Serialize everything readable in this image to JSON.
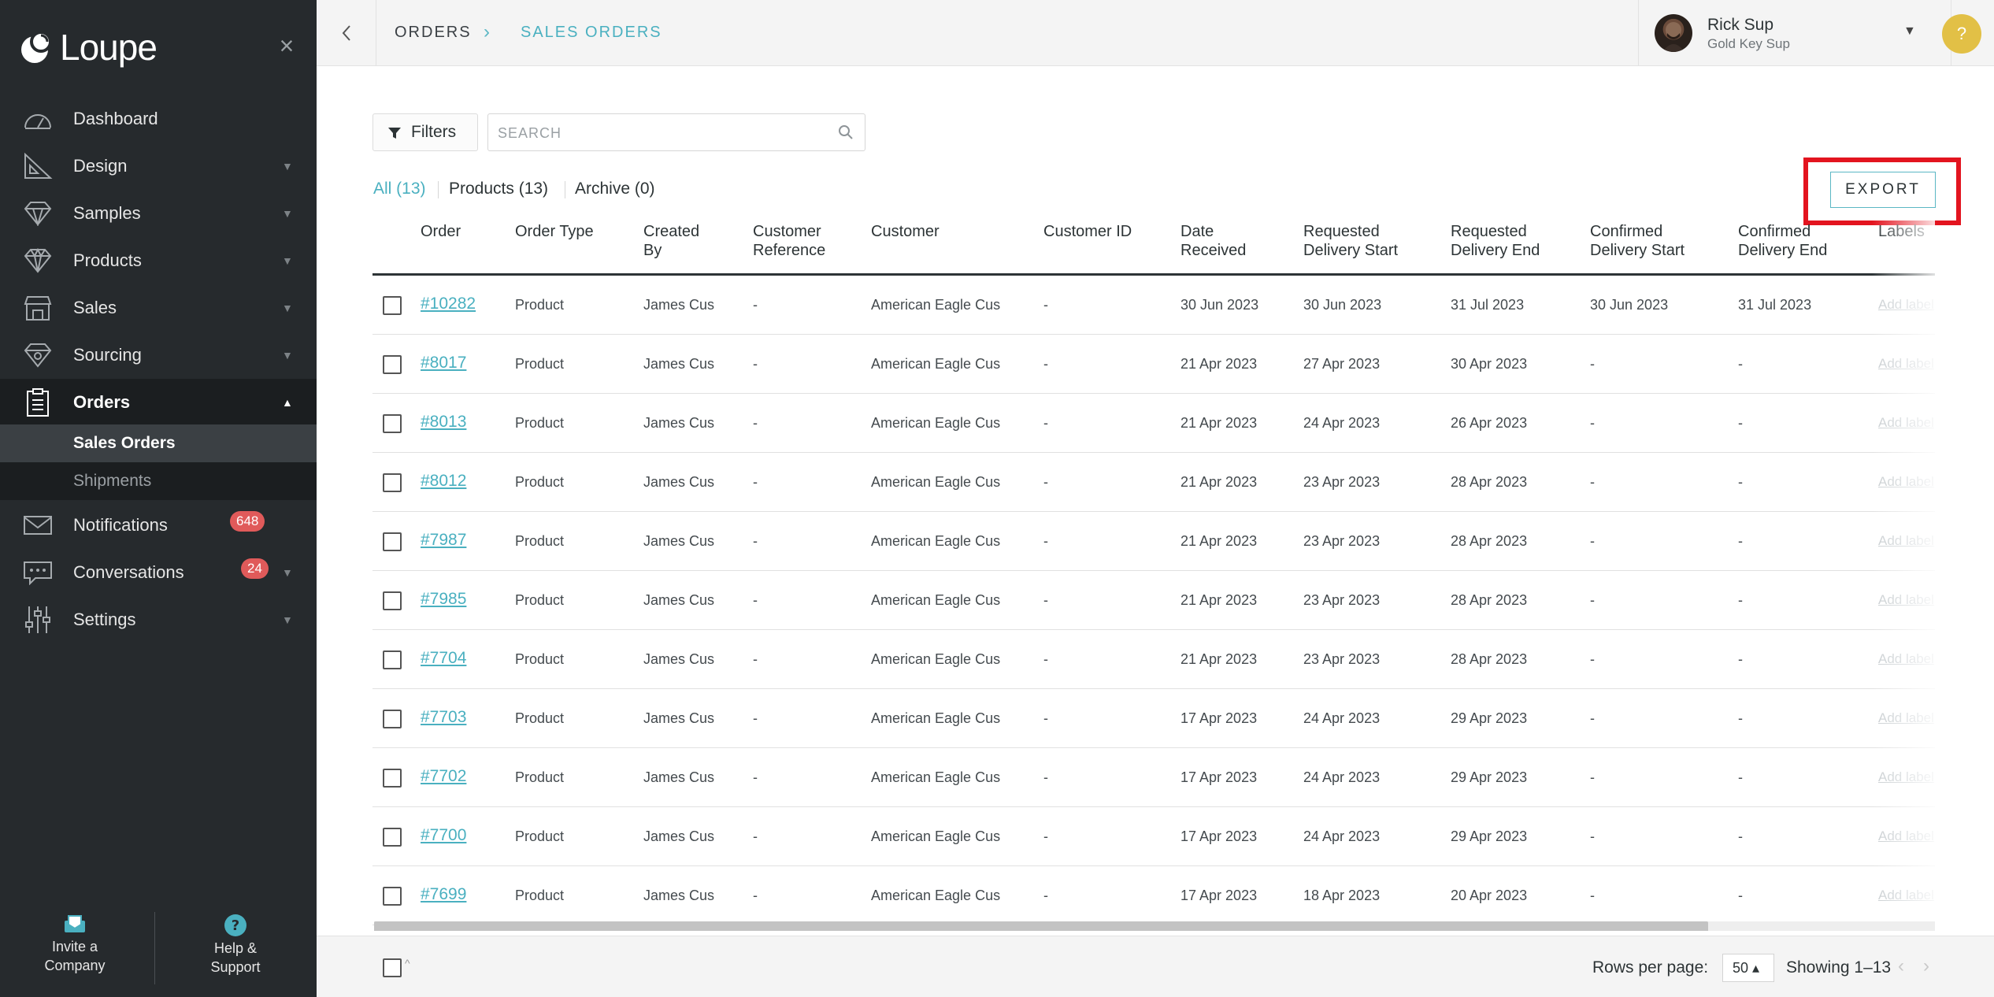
{
  "brand": {
    "name": "Loupe"
  },
  "sidebar": {
    "items": [
      {
        "label": "Dashboard",
        "icon": "dashboard-icon"
      },
      {
        "label": "Design",
        "icon": "design-icon"
      },
      {
        "label": "Samples",
        "icon": "gem-icon"
      },
      {
        "label": "Products",
        "icon": "diamond-icon"
      },
      {
        "label": "Sales",
        "icon": "store-icon"
      },
      {
        "label": "Sourcing",
        "icon": "sourcing-icon"
      },
      {
        "label": "Orders",
        "icon": "clipboard-icon"
      },
      {
        "label": "Notifications",
        "icon": "envelope-icon",
        "badge": "648"
      },
      {
        "label": "Conversations",
        "icon": "chat-icon",
        "badge": "24"
      },
      {
        "label": "Settings",
        "icon": "sliders-icon"
      }
    ],
    "orders_sub": [
      "Sales Orders",
      "Shipments"
    ],
    "footer": {
      "invite": "Invite a Company",
      "invite_line1": "Invite a",
      "invite_line2": "Company",
      "help_line1": "Help &",
      "help_line2": "Support"
    }
  },
  "topbar": {
    "breadcrumb": [
      "ORDERS",
      "SALES ORDERS"
    ],
    "user": {
      "name": "Rick Sup",
      "role": "Gold Key Sup"
    },
    "help_glyph": "?"
  },
  "toolbar": {
    "filters_label": "Filters",
    "search_placeholder": "SEARCH",
    "export_label": "EXPORT"
  },
  "tabs": [
    {
      "label": "All (13)"
    },
    {
      "label": "Products (13)"
    },
    {
      "label": "Archive (0)"
    }
  ],
  "table": {
    "columns": [
      [
        "Order",
        ""
      ],
      [
        "Order Type",
        ""
      ],
      [
        "Created",
        "By"
      ],
      [
        "Customer",
        "Reference"
      ],
      [
        "Customer",
        ""
      ],
      [
        "Customer ID",
        ""
      ],
      [
        "Date",
        "Received"
      ],
      [
        "Requested",
        "Delivery Start"
      ],
      [
        "Requested",
        "Delivery End"
      ],
      [
        "Confirmed",
        "Delivery Start"
      ],
      [
        "Confirmed",
        "Delivery End"
      ],
      [
        "Labels",
        ""
      ]
    ],
    "add_label_text": "Add label",
    "rows": [
      [
        "#10282",
        "Product",
        "James Cus",
        "-",
        "American Eagle Cus",
        "-",
        "30 Jun 2023",
        "30 Jun 2023",
        "31 Jul 2023",
        "30 Jun 2023",
        "31 Jul 2023"
      ],
      [
        "#8017",
        "Product",
        "James Cus",
        "-",
        "American Eagle Cus",
        "-",
        "21 Apr 2023",
        "27 Apr 2023",
        "30 Apr 2023",
        "-",
        "-"
      ],
      [
        "#8013",
        "Product",
        "James Cus",
        "-",
        "American Eagle Cus",
        "-",
        "21 Apr 2023",
        "24 Apr 2023",
        "26 Apr 2023",
        "-",
        "-"
      ],
      [
        "#8012",
        "Product",
        "James Cus",
        "-",
        "American Eagle Cus",
        "-",
        "21 Apr 2023",
        "23 Apr 2023",
        "28 Apr 2023",
        "-",
        "-"
      ],
      [
        "#7987",
        "Product",
        "James Cus",
        "-",
        "American Eagle Cus",
        "-",
        "21 Apr 2023",
        "23 Apr 2023",
        "28 Apr 2023",
        "-",
        "-"
      ],
      [
        "#7985",
        "Product",
        "James Cus",
        "-",
        "American Eagle Cus",
        "-",
        "21 Apr 2023",
        "23 Apr 2023",
        "28 Apr 2023",
        "-",
        "-"
      ],
      [
        "#7704",
        "Product",
        "James Cus",
        "-",
        "American Eagle Cus",
        "-",
        "21 Apr 2023",
        "23 Apr 2023",
        "28 Apr 2023",
        "-",
        "-"
      ],
      [
        "#7703",
        "Product",
        "James Cus",
        "-",
        "American Eagle Cus",
        "-",
        "17 Apr 2023",
        "24 Apr 2023",
        "29 Apr 2023",
        "-",
        "-"
      ],
      [
        "#7702",
        "Product",
        "James Cus",
        "-",
        "American Eagle Cus",
        "-",
        "17 Apr 2023",
        "24 Apr 2023",
        "29 Apr 2023",
        "-",
        "-"
      ],
      [
        "#7700",
        "Product",
        "James Cus",
        "-",
        "American Eagle Cus",
        "-",
        "17 Apr 2023",
        "24 Apr 2023",
        "29 Apr 2023",
        "-",
        "-"
      ],
      [
        "#7699",
        "Product",
        "James Cus",
        "-",
        "American Eagle Cus",
        "-",
        "17 Apr 2023",
        "18 Apr 2023",
        "20 Apr 2023",
        "-",
        "-"
      ]
    ]
  },
  "footer": {
    "rows_per_page_label": "Rows per page:",
    "rows_per_page_value": "50 ▴",
    "showing": "Showing 1–13"
  },
  "colors": {
    "accent": "#4ab0c0",
    "sidebar_bg": "#262a2d",
    "badge": "#e05a5a",
    "highlight": "#e3141f",
    "help": "#e2c046"
  }
}
